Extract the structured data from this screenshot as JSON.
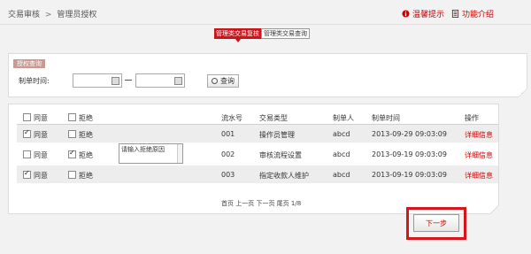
{
  "header": {
    "breadcrumb_root": "交易审核",
    "breadcrumb_sep": ">",
    "breadcrumb_current": "管理员授权",
    "hint_label": "温馨提示",
    "intro_label": "功能介绍"
  },
  "tabs": [
    {
      "label": "管理类交易复核",
      "active": true
    },
    {
      "label": "管理类交易查询",
      "active": false
    }
  ],
  "query": {
    "tag": "授权查询",
    "time_label": "制单时间:",
    "start_value": "",
    "end_value": "",
    "search_label": "查询"
  },
  "table": {
    "headers": {
      "agree": "同意",
      "reject": "拒绝",
      "serial": "流水号",
      "type": "交易类型",
      "maker": "制单人",
      "time": "制单时间",
      "op": "操作"
    },
    "rows": [
      {
        "agree": "同意",
        "agree_checked": true,
        "reject": "拒绝",
        "reject_checked": false,
        "serial": "001",
        "type": "操作员管理",
        "maker": "abcd",
        "time": "2013-09-29 09:03:09",
        "op": "详细信息"
      },
      {
        "agree": "同意",
        "agree_checked": false,
        "reject": "拒绝",
        "reject_checked": true,
        "reason": "请输入拒绝原因",
        "serial": "002",
        "type": "审核流程设置",
        "maker": "abcd",
        "time": "2013-09-19 09:03:09",
        "op": "详细信息"
      },
      {
        "agree": "同意",
        "agree_checked": true,
        "reject": "拒绝",
        "reject_checked": false,
        "serial": "003",
        "type": "指定收款人维护",
        "maker": "abcd",
        "time": "2013-09-19 09:03:09",
        "op": "详细信息"
      }
    ],
    "pager": "首页 上一页 下一页 尾页 1/8"
  },
  "actions": {
    "next_label": "下一步"
  },
  "colors": {
    "accent": "#c8161d",
    "link": "#cc0000",
    "highlight": "#d9141b"
  }
}
